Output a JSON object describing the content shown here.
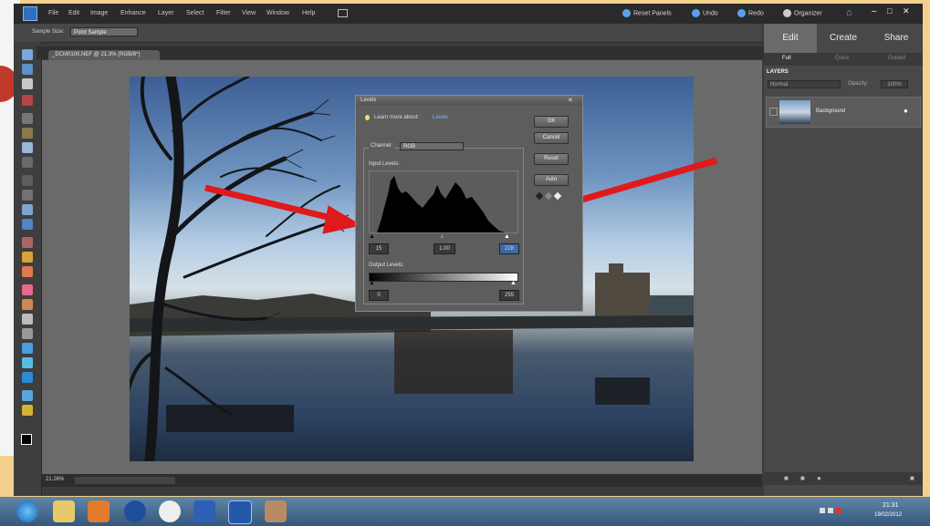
{
  "menubar": {
    "menus": [
      "File",
      "Edit",
      "Image",
      "Enhance",
      "Layer",
      "Select",
      "Filter",
      "View",
      "Window",
      "Help"
    ],
    "reset_panels": "Reset Panels",
    "undo": "Undo",
    "redo": "Redo",
    "organizer": "Organizer"
  },
  "optbar": {
    "sample_size_label": "Sample Size:",
    "sample_size_value": "Point Sample"
  },
  "document": {
    "tab_title": "_DCM0100.NEF @ 21.3% (RGB/8*)",
    "zoom": "21.26%"
  },
  "panel": {
    "tabs": [
      "Edit",
      "Create",
      "Share"
    ],
    "subtabs": [
      "Full",
      "Quick",
      "Guided"
    ],
    "layers_title": "LAYERS",
    "blend_mode": "Normal",
    "opacity_label": "Opacity:",
    "opacity_value": "100%",
    "layer_name": "Background"
  },
  "levels": {
    "title": "Levels",
    "learn_text": "Learn more about:",
    "learn_link": "Levels",
    "channel_label": "Channel:",
    "channel_value": "RGB",
    "input_label": "Input Levels:",
    "output_label": "Output Levels:",
    "input_black": "15",
    "input_mid": "1.00",
    "input_white": "228",
    "output_black": "0",
    "output_white": "255",
    "buttons": {
      "ok": "OK",
      "cancel": "Cancel",
      "reset": "Reset",
      "auto": "Auto"
    }
  },
  "taskbar": {
    "time": "21:31",
    "date": "19/02/2012"
  },
  "colors": {
    "arrow": "#e0191a",
    "accent": "#5aa0ef"
  }
}
